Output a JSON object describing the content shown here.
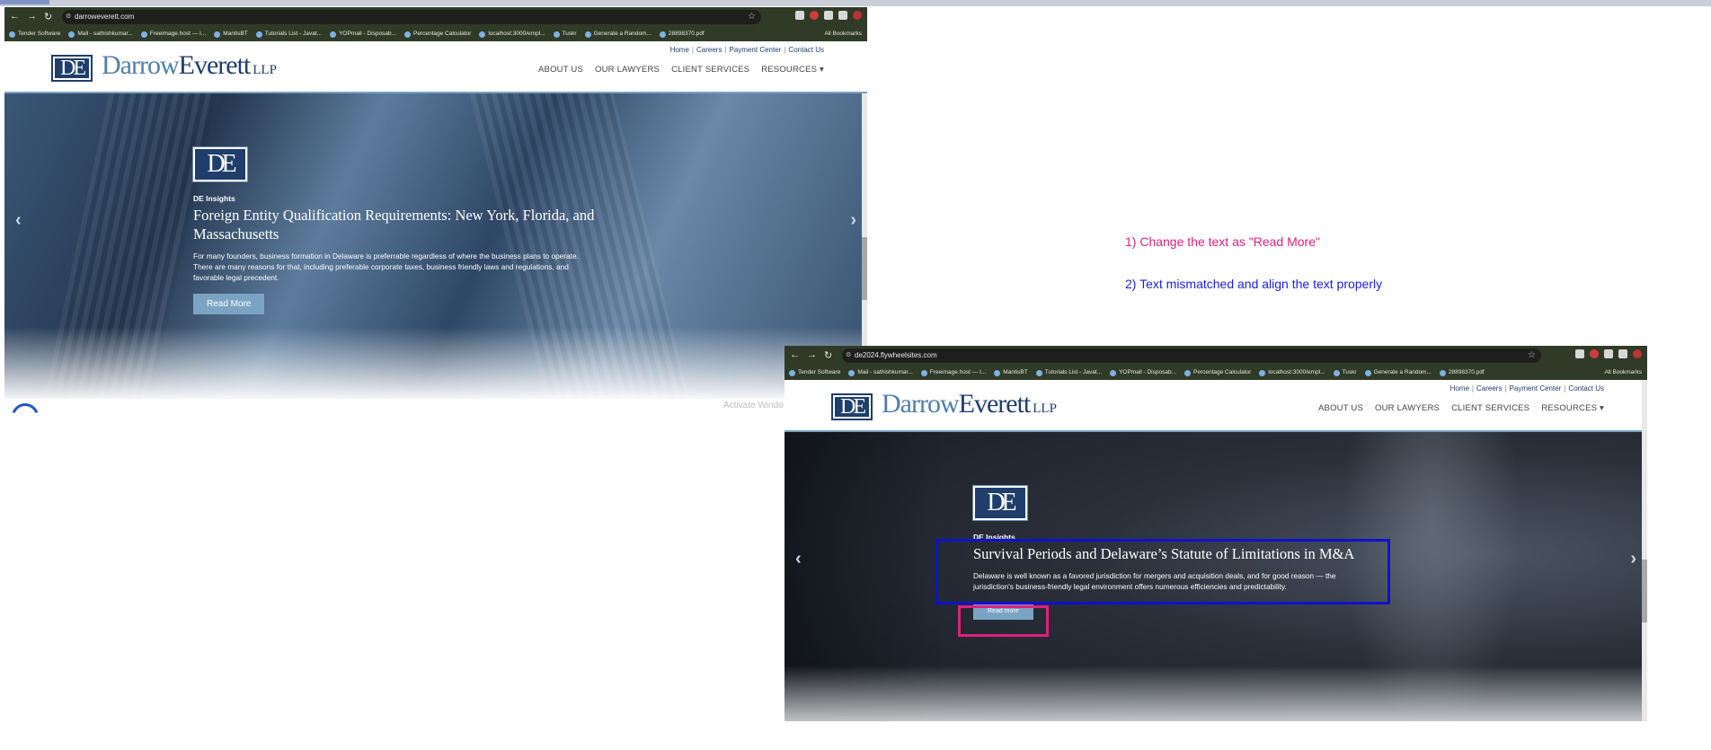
{
  "notes": {
    "note1": "1) Change the text as \"Read More\"",
    "note2": "2) Text mismatched and align the text properly"
  },
  "colors": {
    "note1": "#e0207e",
    "note2": "#1a1ee0",
    "brand_navy": "#1f3e6b",
    "brand_light": "#4f7faa",
    "button": "#7aa4c2"
  },
  "bookmarks": [
    "Tender Software",
    "Mail - sathishkumar...",
    "Freeimage.host — I...",
    "MantisBT",
    "Tutorials List - Javat...",
    "YOPmail - Disposab...",
    "Percentage Calculator",
    "localhost:3000/empl...",
    "Tuskr",
    "Generate a Random...",
    "28898370.pdf"
  ],
  "bookmarks_all": "All Bookmarks",
  "site": {
    "logo_mark": "DE",
    "logo_first": "Darrow",
    "logo_second": "Everett",
    "logo_suffix": "LLP",
    "util_links": [
      "Home",
      "Careers",
      "Payment Center",
      "Contact Us"
    ],
    "nav": [
      "ABOUT US",
      "OUR LAWYERS",
      "CLIENT SERVICES",
      "RESOURCES ▾"
    ],
    "insights_label": "DE Insights"
  },
  "shot1": {
    "url": "darroweverett.com",
    "hero_title": "Foreign Entity Qualification Requirements: New York, Florida, and Massachusetts",
    "hero_desc": "For many founders, business formation in Delaware is preferrable regardless of where the business plans to operate. There are many reasons for that, including preferable corporate taxes, business friendly laws and regulations, and favorable legal precedent.",
    "button": "Read More",
    "watermark": "Activate Windo"
  },
  "shot2": {
    "url": "de2024.flywheelsites.com",
    "hero_title": "Survival Periods and Delaware’s Statute of Limitations in M&A",
    "hero_desc": "Delaware is well known as a favored jurisdiction for mergers and acquisition deals, and for good reason — the jurisdiction's business-friendly legal environment offers numerous efficiencies and predictability.",
    "button": "Read more"
  }
}
